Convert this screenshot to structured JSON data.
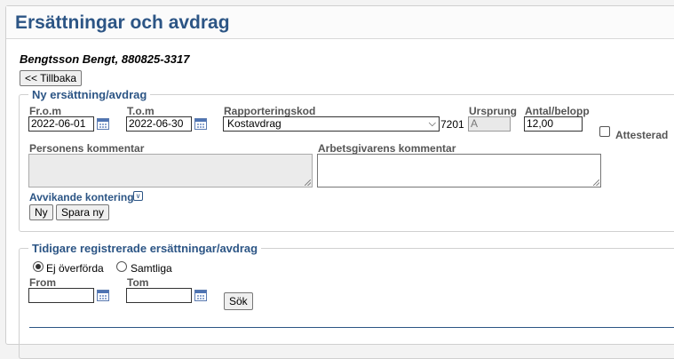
{
  "header": {
    "title": "Ersättningar och avdrag"
  },
  "person": {
    "name": "Bengtsson Bengt, 880825-3317"
  },
  "back_button": "<< Tillbaka",
  "new_section": {
    "legend": "Ny ersättning/avdrag",
    "from_label": "Fr.o.m",
    "from_value": "2022-06-01",
    "to_label": "T.o.m",
    "to_value": "2022-06-30",
    "code_label": "Rapporteringskod",
    "code_selected": "Kostavdrag",
    "code_number": "7201",
    "origin_label": "Ursprung",
    "origin_value": "A",
    "amount_label": "Antal/belopp",
    "amount_value": "12,00",
    "attested_label": "Attesterad",
    "person_comment_label": "Personens kommentar",
    "employer_comment_label": "Arbetsgivarens kommentar",
    "deviating_account_label": "Avvikande kontering",
    "new_button": "Ny",
    "save_new_button": "Spara ny"
  },
  "previous_section": {
    "legend": "Tidigare registrerade ersättningar/avdrag",
    "radio_not_transferred": "Ej överförda",
    "radio_all": "Samtliga",
    "from_label": "From",
    "to_label": "Tom",
    "search_button": "Sök"
  }
}
